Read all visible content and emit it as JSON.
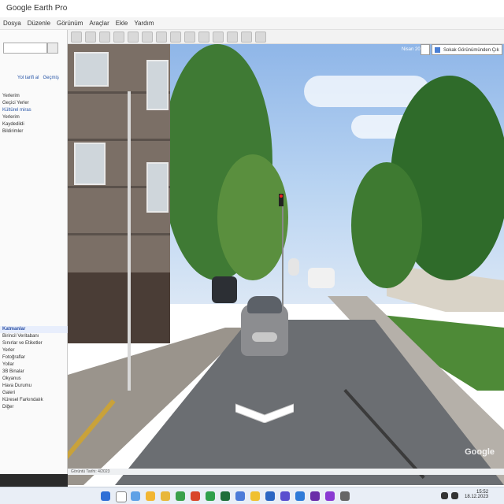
{
  "window": {
    "title": "Google Earth Pro"
  },
  "menubar": {
    "items": [
      "Dosya",
      "Düzenle",
      "Görünüm",
      "Araçlar",
      "Ekle",
      "Yardım"
    ]
  },
  "sidebar": {
    "search_links": [
      "Yol tarifi al",
      "Geçmiş"
    ],
    "places_items": [
      "Yerlerim",
      "Geçici Yerler",
      "Kültürel miras",
      "Yerlerim",
      "Kaydedildi",
      "Bildirimler"
    ],
    "layers_header": "Katmanlar",
    "layers_items": [
      "Birincil Veritabanı",
      "Sınırlar ve Etiketler",
      "Yerler",
      "Fotoğraflar",
      "Yollar",
      "3B Binalar",
      "Okyanus",
      "Hava Durumu",
      "Galeri",
      "Küresel Farkındalık",
      "Diğer"
    ]
  },
  "streetview": {
    "header_date": "Nisan 2023",
    "exit_button": "Sokak Görünümünden Çık",
    "watermark": "Google",
    "status": "Görüntü Tarihi: 4/2023"
  },
  "taskbar": {
    "time": "15:52",
    "date": "18.12.2023",
    "tray_icons": [
      "wifi-icon",
      "speaker-icon",
      "battery-icon"
    ]
  }
}
